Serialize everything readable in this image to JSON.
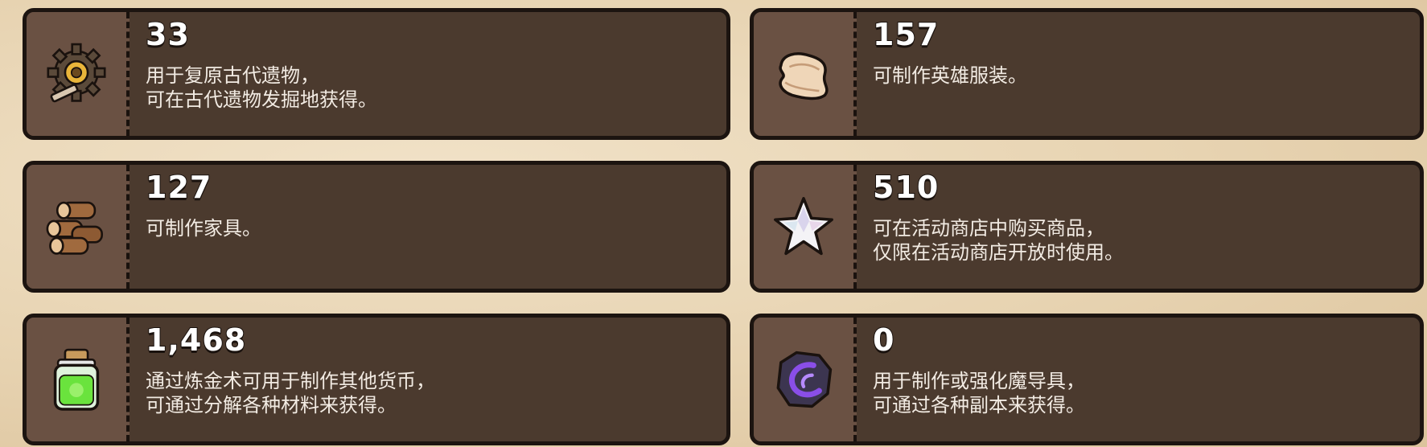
{
  "items": [
    {
      "icon": "relic-gear-icon",
      "count": "33",
      "description": "用于复原古代遗物，\n可在古代遗物发掘地获得。"
    },
    {
      "icon": "cloth-icon",
      "count": "157",
      "description": "可制作英雄服装。"
    },
    {
      "icon": "wood-logs-icon",
      "count": "127",
      "description": "可制作家具。"
    },
    {
      "icon": "star-crystal-icon",
      "count": "510",
      "description": "可在活动商店中购买商品，\n仅限在活动商店开放时使用。"
    },
    {
      "icon": "green-potion-jar-icon",
      "count": "1,468",
      "description": "通过炼金术可用于制作其他货币，\n可通过分解各种材料来获得。"
    },
    {
      "icon": "dark-rune-stone-icon",
      "count": "0",
      "description": "用于制作或强化魔导具，\n可通过各种副本来获得。"
    }
  ],
  "colors": {
    "card_bg": "#4b3a2e",
    "icon_panel_bg": "#6a5143",
    "border": "#1c1410",
    "text": "#f2ebe3"
  }
}
